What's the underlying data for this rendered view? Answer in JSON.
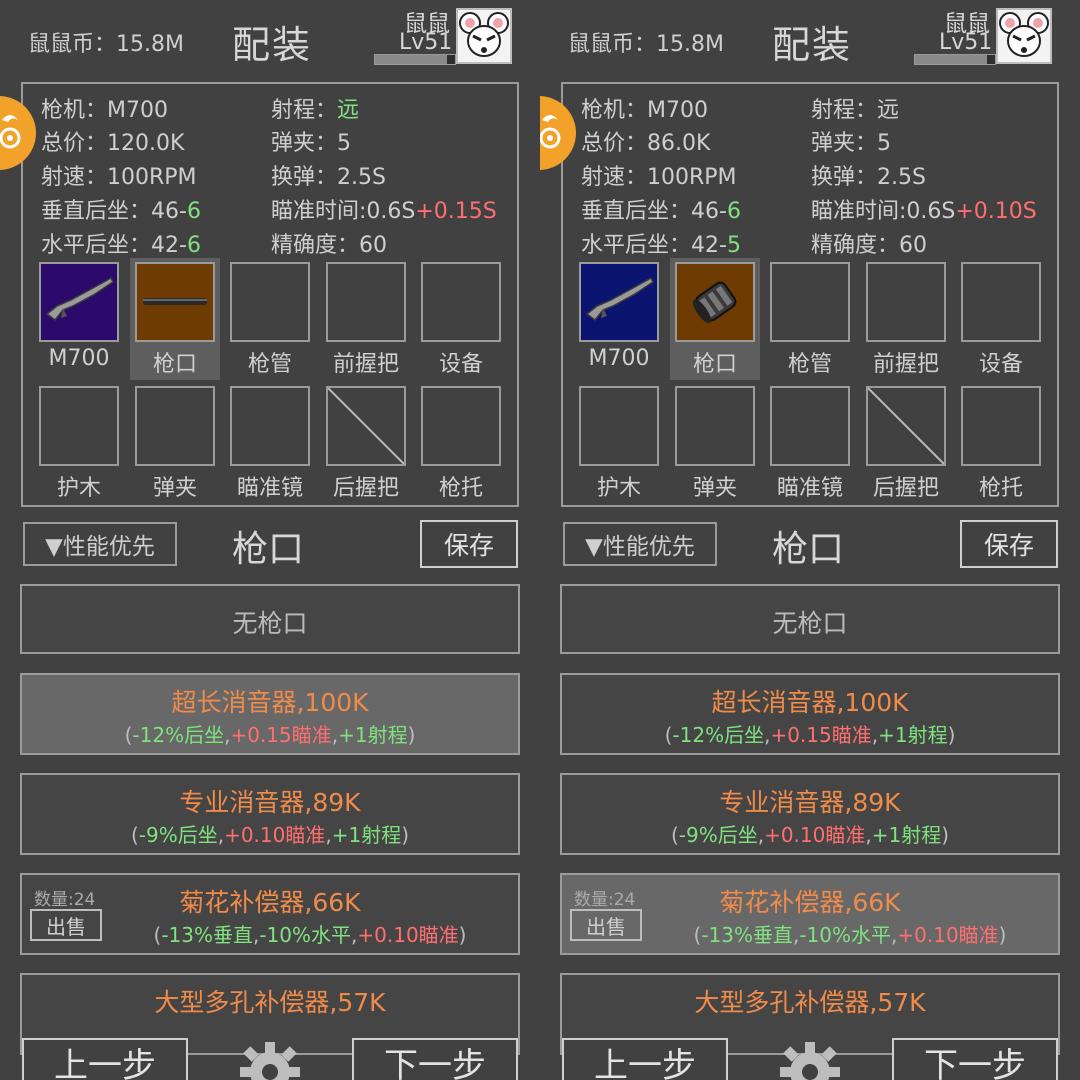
{
  "panels": [
    {
      "header": {
        "coins": "鼠鼠币：15.8M",
        "title": "配装",
        "user_name": "鼠鼠",
        "level": "Lv51",
        "xp_fraction": 0.9
      },
      "stats": {
        "gun_label": "枪机：",
        "gun": "M700",
        "range_label": "射程：",
        "range": "远",
        "price_label": "总价：",
        "price": "120.0K",
        "mag_label": "弹夹：",
        "mag": "5",
        "rate_label": "射速：",
        "rate": "100RPM",
        "reload_label": "换弹：",
        "reload": "2.5S",
        "vrecoil_label": "垂直后坐：",
        "vrecoil": "46-",
        "vrecoil_delta": "6",
        "aim_label": "瞄准时间:",
        "aim": "0.6S",
        "aim_delta": "+0.15S",
        "hrecoil_label": "水平后坐：",
        "hrecoil": "42-",
        "hrecoil_delta": "6",
        "acc_label": "精确度：",
        "acc": "60"
      },
      "slots_row1": [
        "M700",
        "枪口",
        "枪管",
        "前握把",
        "设备"
      ],
      "slots_row2": [
        "护木",
        "弹夹",
        "瞄准镜",
        "后握把",
        "枪托"
      ],
      "toolbar": {
        "sort": "▼性能优先",
        "category": "枪口",
        "save": "保存"
      },
      "items": {
        "none": "无枪口",
        "i1": {
          "name": "超长消音器,100K",
          "open": "(",
          "e1": "-12%后坐",
          "c1": ",",
          "e2": "+0.15瞄准",
          "c2": ",",
          "e3": "+1射程",
          "close": ")"
        },
        "i2": {
          "name": "专业消音器,89K",
          "open": "(",
          "e1": "-9%后坐",
          "c1": ",",
          "e2": "+0.10瞄准",
          "c2": ",",
          "e3": "+1射程",
          "close": ")"
        },
        "i3": {
          "name": "菊花补偿器,66K",
          "qty": "数量:24",
          "sell": "出售",
          "open": "(",
          "e1": "-13%垂直",
          "c1": ",",
          "e2": "-10%水平",
          "c2": ",",
          "e3": "+0.10瞄准",
          "close": ")"
        },
        "i4": {
          "name": "大型多孔补偿器,57K"
        }
      },
      "footer": {
        "prev": "上一步",
        "next": "下一步"
      }
    },
    {
      "header": {
        "coins": "鼠鼠币：15.8M",
        "title": "配装",
        "user_name": "鼠鼠",
        "level": "Lv51",
        "xp_fraction": 0.9
      },
      "stats": {
        "gun_label": "枪机：",
        "gun": "M700",
        "range_label": "射程：",
        "range": "远",
        "price_label": "总价：",
        "price": "86.0K",
        "mag_label": "弹夹：",
        "mag": "5",
        "rate_label": "射速：",
        "rate": "100RPM",
        "reload_label": "换弹：",
        "reload": "2.5S",
        "vrecoil_label": "垂直后坐：",
        "vrecoil": "46-",
        "vrecoil_delta": "6",
        "aim_label": "瞄准时间:",
        "aim": "0.6S",
        "aim_delta": "+0.10S",
        "hrecoil_label": "水平后坐：",
        "hrecoil": "42-",
        "hrecoil_delta": "5",
        "acc_label": "精确度：",
        "acc": "60"
      },
      "slots_row1": [
        "M700",
        "枪口",
        "枪管",
        "前握把",
        "设备"
      ],
      "slots_row2": [
        "护木",
        "弹夹",
        "瞄准镜",
        "后握把",
        "枪托"
      ],
      "toolbar": {
        "sort": "▼性能优先",
        "category": "枪口",
        "save": "保存"
      },
      "items": {
        "none": "无枪口",
        "i1": {
          "name": "超长消音器,100K",
          "open": "(",
          "e1": "-12%后坐",
          "c1": ",",
          "e2": "+0.15瞄准",
          "c2": ",",
          "e3": "+1射程",
          "close": ")"
        },
        "i2": {
          "name": "专业消音器,89K",
          "open": "(",
          "e1": "-9%后坐",
          "c1": ",",
          "e2": "+0.10瞄准",
          "c2": ",",
          "e3": "+1射程",
          "close": ")"
        },
        "i3": {
          "name": "菊花补偿器,66K",
          "qty": "数量:24",
          "sell": "出售",
          "open": "(",
          "e1": "-13%垂直",
          "c1": ",",
          "e2": "-10%水平",
          "c2": ",",
          "e3": "+0.10瞄准",
          "close": ")"
        },
        "i4": {
          "name": "大型多孔补偿器,57K"
        }
      },
      "footer": {
        "prev": "上一步",
        "next": "下一步"
      }
    }
  ],
  "icons": [
    "rifle-icon",
    "muzzle-barrel-icon",
    "compensator-icon",
    "gear-icon",
    "mouse-avatar-icon",
    "badge-icon"
  ],
  "colors": {
    "positive": "#7fe27f",
    "negative": "#ff6f6f",
    "item_name": "#f08b4a"
  }
}
